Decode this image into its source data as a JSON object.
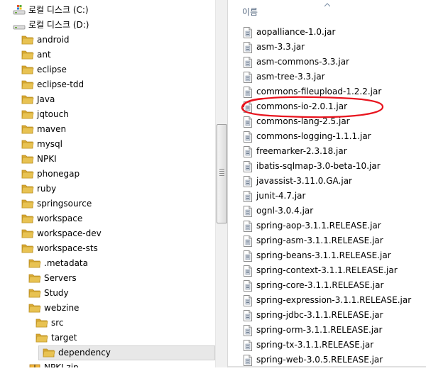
{
  "tree": {
    "items": [
      {
        "label": "로컬 디스크 (C:)",
        "kind": "drive-windows",
        "level": 0
      },
      {
        "label": "로컬 디스크 (D:)",
        "kind": "drive",
        "level": 0
      },
      {
        "label": "android",
        "kind": "folder",
        "level": 1
      },
      {
        "label": "ant",
        "kind": "folder",
        "level": 1
      },
      {
        "label": "eclipse",
        "kind": "folder",
        "level": 1
      },
      {
        "label": "eclipse-tdd",
        "kind": "folder",
        "level": 1
      },
      {
        "label": "Java",
        "kind": "folder",
        "level": 1
      },
      {
        "label": "jqtouch",
        "kind": "folder",
        "level": 1
      },
      {
        "label": "maven",
        "kind": "folder",
        "level": 1
      },
      {
        "label": "mysql",
        "kind": "folder",
        "level": 1
      },
      {
        "label": "NPKI",
        "kind": "folder",
        "level": 1
      },
      {
        "label": "phonegap",
        "kind": "folder",
        "level": 1
      },
      {
        "label": "ruby",
        "kind": "folder",
        "level": 1
      },
      {
        "label": "springsource",
        "kind": "folder",
        "level": 1
      },
      {
        "label": "workspace",
        "kind": "folder",
        "level": 1
      },
      {
        "label": "workspace-dev",
        "kind": "folder",
        "level": 1
      },
      {
        "label": "workspace-sts",
        "kind": "folder",
        "level": 1
      },
      {
        "label": ".metadata",
        "kind": "folder",
        "level": 2
      },
      {
        "label": "Servers",
        "kind": "folder",
        "level": 2
      },
      {
        "label": "Study",
        "kind": "folder",
        "level": 2
      },
      {
        "label": "webzine",
        "kind": "folder",
        "level": 2
      },
      {
        "label": "src",
        "kind": "folder",
        "level": 3
      },
      {
        "label": "target",
        "kind": "folder",
        "level": 3
      },
      {
        "label": "dependency",
        "kind": "folder",
        "level": 4,
        "selected": true
      },
      {
        "label": "NPKI.zip",
        "kind": "zip",
        "level": 2
      }
    ]
  },
  "file_list": {
    "column_header": "이름",
    "files": [
      "aopalliance-1.0.jar",
      "asm-3.3.jar",
      "asm-commons-3.3.jar",
      "asm-tree-3.3.jar",
      "commons-fileupload-1.2.2.jar",
      "commons-io-2.0.1.jar",
      "commons-lang-2.5.jar",
      "commons-logging-1.1.1.jar",
      "freemarker-2.3.18.jar",
      "ibatis-sqlmap-3.0-beta-10.jar",
      "javassist-3.11.0.GA.jar",
      "junit-4.7.jar",
      "ognl-3.0.4.jar",
      "spring-aop-3.1.1.RELEASE.jar",
      "spring-asm-3.1.1.RELEASE.jar",
      "spring-beans-3.1.1.RELEASE.jar",
      "spring-context-3.1.1.RELEASE.jar",
      "spring-core-3.1.1.RELEASE.jar",
      "spring-expression-3.1.1.RELEASE.jar",
      "spring-jdbc-3.1.1.RELEASE.jar",
      "spring-orm-3.1.1.RELEASE.jar",
      "spring-tx-3.1.1.RELEASE.jar",
      "spring-web-3.0.5.RELEASE.jar"
    ],
    "highlighted_file": "commons-io-2.0.1.jar"
  },
  "icons": {
    "folder": "folder-icon",
    "drive": "drive-icon",
    "jar": "jar-file-icon",
    "zip": "zip-file-icon",
    "sort": "sort-up-icon"
  },
  "colors": {
    "folder": "#e8c252",
    "header_text": "#4c607a",
    "highlight_oval": "#e8141e",
    "selection": "#e8e8e8"
  }
}
